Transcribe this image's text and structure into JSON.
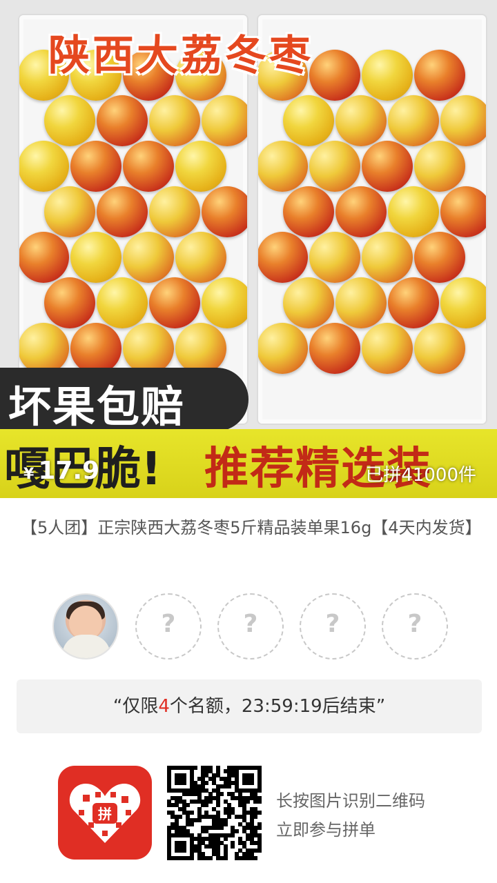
{
  "hero": {
    "banner_title": "陕西大荔冬枣",
    "guarantee": "坏果包赔",
    "crisp": "嘎巴脆!",
    "recommend": "推荐精选装",
    "price_symbol": "¥",
    "price": "17.9",
    "sold_count": "已拼41000件"
  },
  "product": {
    "title": "【5人团】正宗陕西大荔冬枣5斤精品装单果16g【4天内发货】"
  },
  "group": {
    "empty_slot_symbol": "?",
    "slots_total": 5,
    "slots_filled": 1
  },
  "quota": {
    "open_quote": "“",
    "prefix": "仅限",
    "remaining": "4",
    "middle": "个名额，",
    "countdown": "23:59:19",
    "suffix": "后结束",
    "close_quote": "”"
  },
  "footer": {
    "logo_char": "拼",
    "line1": "长按图片识别二维码",
    "line2": "立即参与拼单"
  },
  "colors": {
    "brand_red": "#e02e24",
    "title_orange": "#e5481f",
    "strip_yellow": "#e7e52a"
  }
}
